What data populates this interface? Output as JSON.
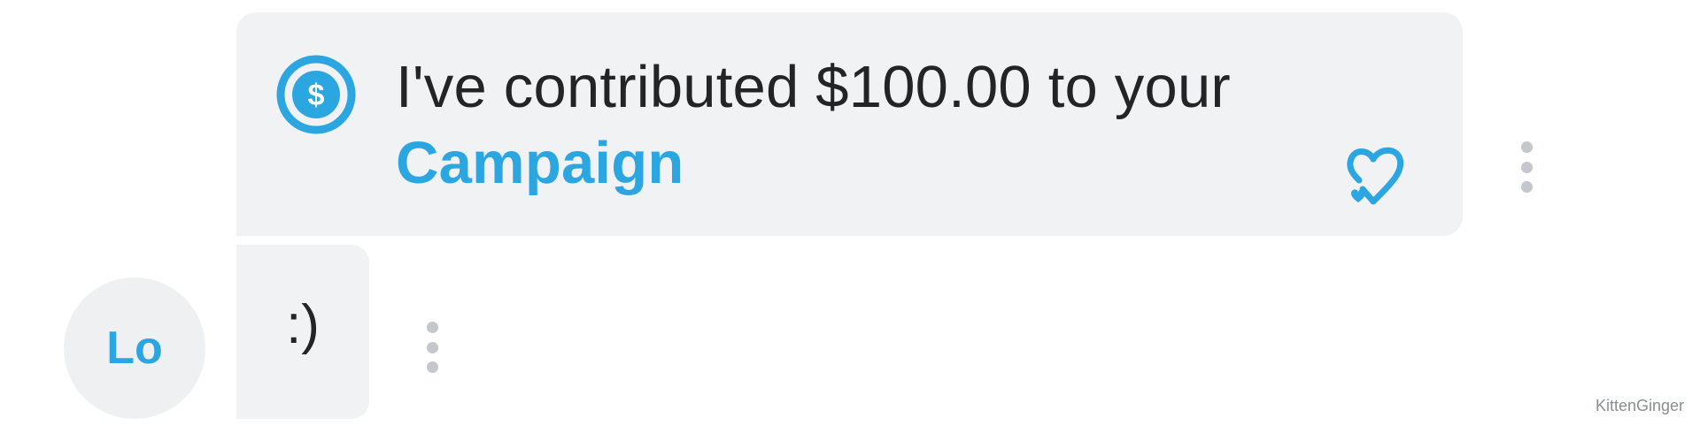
{
  "contribution_message": {
    "text": "I've contributed $100.00 to your",
    "link_label": "Campaign",
    "icon": "dollar-circle-icon",
    "reaction_icon": "heart-check-icon"
  },
  "reply_message": {
    "text": ":)"
  },
  "sender": {
    "avatar_initials": "Lo"
  },
  "watermark": {
    "text": "KittenGinger"
  },
  "colors": {
    "accent": "#2ba6e0",
    "bubble_bg": "#f0f2f4",
    "text": "#222426",
    "kebab": "#c4c7cb"
  }
}
